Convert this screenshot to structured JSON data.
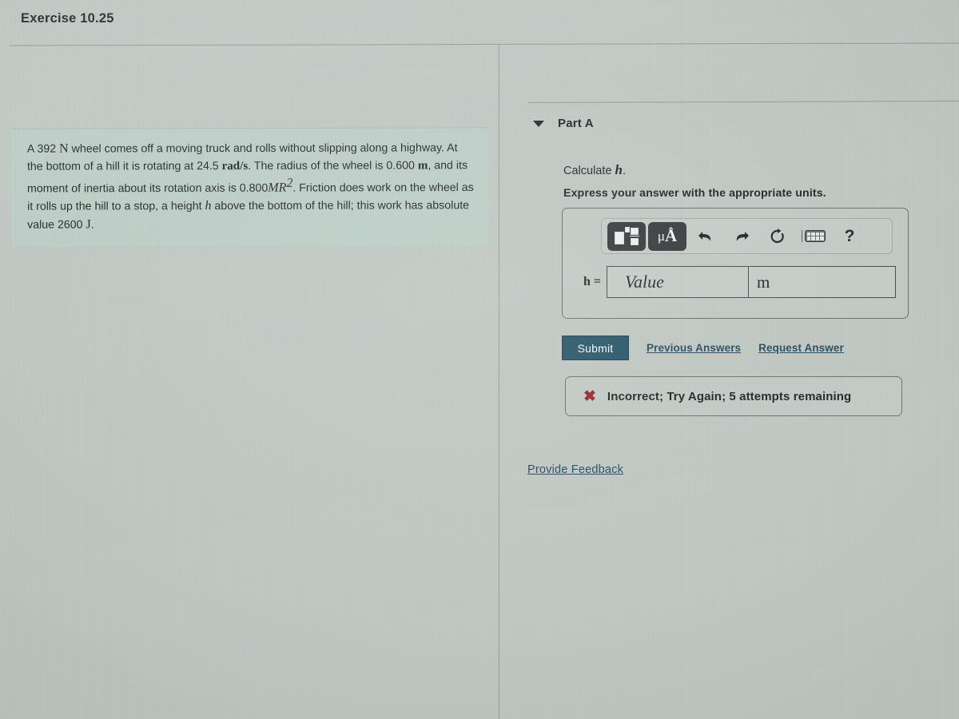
{
  "header": {
    "exercise_title": "Exercise 10.25"
  },
  "problem": {
    "text_segments": {
      "s1": "A 392 ",
      "unit_newton": "N",
      "s2": " wheel comes off a moving truck and rolls without slipping along a highway. At the bottom of a hill it is rotating at 24.5 ",
      "unit_rad_s": "rad/s",
      "s3": ". The radius of the wheel is 0.600 ",
      "unit_m": "m",
      "s4": ", and its moment of inertia about its rotation axis is 0.800",
      "moment_expr": "MR",
      "moment_exp": "2",
      "s5": ". Friction does work on the wheel as it rolls up the hill to a stop, a height ",
      "var_h": "h",
      "s6": " above the bottom of the hill; this work has absolute value 2600 ",
      "unit_joule": "J",
      "s7": "."
    }
  },
  "part": {
    "label": "Part A",
    "collapse_state": "expanded",
    "question_prefix": "Calculate ",
    "question_variable": "h",
    "question_suffix": ".",
    "instruction": "Express your answer with the appropriate units."
  },
  "answer": {
    "variable_label": "h =",
    "value_placeholder": "Value",
    "unit_value": "m",
    "toolbar": {
      "template_button_name": "template-icon",
      "units_button_mu": "μ",
      "units_button_angstrom": "Å",
      "undo_glyph": "↰",
      "redo_glyph": "↱",
      "reset_glyph": "↻",
      "help_glyph": "?"
    }
  },
  "actions": {
    "submit_label": "Submit",
    "previous_answers_label": "Previous Answers",
    "request_answer_label": "Request Answer"
  },
  "feedback": {
    "status_icon": "✖",
    "message": "Incorrect; Try Again; 5 attempts remaining"
  },
  "footer": {
    "provide_feedback_label": "Provide Feedback"
  },
  "colors": {
    "page_background": "#b9c2bd",
    "problem_highlight": "#b5cbc4",
    "submit_button": "#1c4a5d",
    "link": "#1a3f52",
    "incorrect_red": "#8b1a22",
    "toolbar_dark_button": "#2b2e30",
    "divider": "#7f8a86"
  }
}
